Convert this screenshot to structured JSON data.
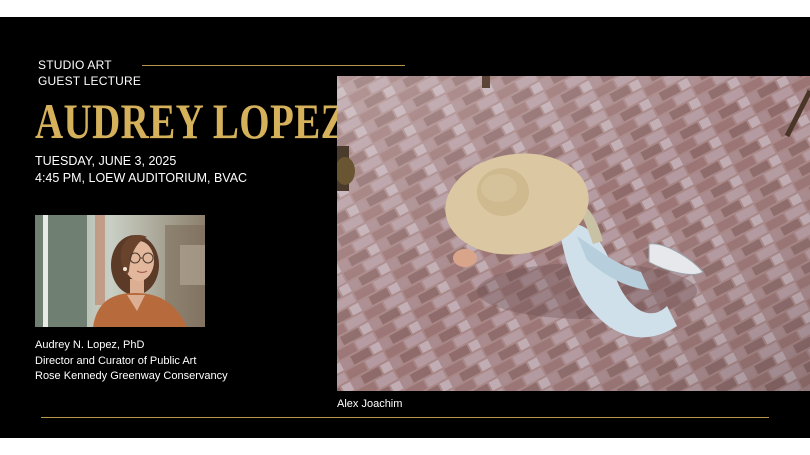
{
  "event": {
    "eyebrow_line1": "STUDIO ART",
    "eyebrow_line2": "GUEST LECTURE",
    "speaker_name": "AUDREY LOPEZ",
    "date": "TUESDAY, JUNE 3, 2025",
    "time_location": "4:45 PM, LOEW AUDITORIUM, BVAC"
  },
  "speaker": {
    "full_name": "Audrey N. Lopez, PhD",
    "role": "Director and Curator of Public Art",
    "organization": "Rose Kennedy Greenway Conservancy"
  },
  "artwork": {
    "photo_credit": "Alex Joachim"
  },
  "colors": {
    "background": "#000000",
    "accent_gold": "#d4b15a",
    "text": "#ffffff"
  }
}
